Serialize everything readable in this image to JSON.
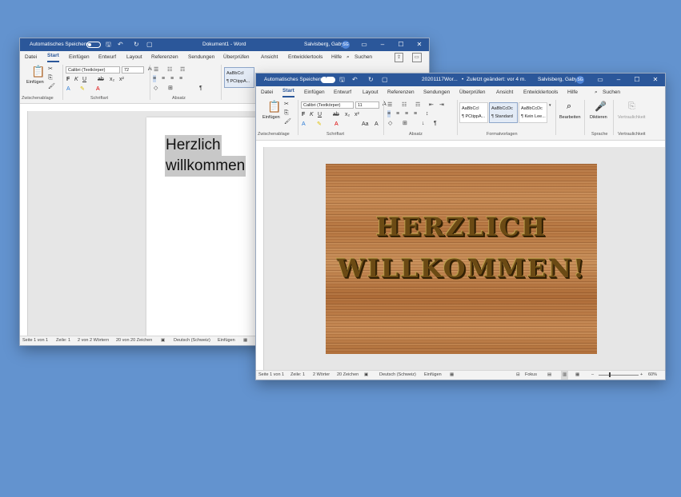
{
  "window1": {
    "autosave_label": "Automatisches Speichern",
    "title": "Dokument1 - Word",
    "user": "Salvisberg, Gaby",
    "user_initials": "SG",
    "tabs": [
      "Datei",
      "Start",
      "Einfügen",
      "Entwurf",
      "Layout",
      "Referenzen",
      "Sendungen",
      "Überprüfen",
      "Ansicht",
      "Entwicklertools",
      "Hilfe"
    ],
    "search_label": "Suchen",
    "font_name": "Calibri (Textkörper)",
    "font_size": "72",
    "paste_label": "Einfügen",
    "clipboard_group": "Zwischenablage",
    "font_group": "Schriftart",
    "paragraph_group": "Absatz",
    "style_preview": "AaBbCcI",
    "style_name": "¶ PCtippA...",
    "doc_lines": [
      "Herzlich",
      "willkommen"
    ],
    "status": {
      "page": "Seite 1 von 1",
      "line": "Zeile: 1",
      "words": "2 von 2 Wörtern",
      "chars": "20 von 20 Zeichen",
      "language": "Deutsch (Schweiz)",
      "mode": "Einfügen"
    }
  },
  "window2": {
    "autosave_label": "Automatisches Speichern",
    "title": "20201117Wor...",
    "subtitle": "Zuletzt geändert: vor 4 m.",
    "user": "Salvisberg, Gaby",
    "user_initials": "SG",
    "tabs": [
      "Datei",
      "Start",
      "Einfügen",
      "Entwurf",
      "Layout",
      "Referenzen",
      "Sendungen",
      "Überprüfen",
      "Ansicht",
      "Entwicklertools",
      "Hilfe"
    ],
    "search_label": "Suchen",
    "font_name": "Calibri (Textkörper)",
    "font_size": "11",
    "paste_label": "Einfügen",
    "groups": [
      "Zwischenablage",
      "Schriftart",
      "Absatz",
      "Formatvorlagen",
      "Sprache",
      "Vertraulichkeit"
    ],
    "styles": [
      {
        "preview": "AaBbCcI",
        "name": "¶ PCtippA..."
      },
      {
        "preview": "AaBbCcDc",
        "name": "¶ Standard"
      },
      {
        "preview": "AaBbCcDc",
        "name": "¶ Kein Lee..."
      }
    ],
    "edit_label": "Bearbeiten",
    "dictate_label": "Diktieren",
    "sensitivity_label": "Vertraulichkeit",
    "wordart_lines": [
      "HERZLICH",
      "WILLKOMMEN!"
    ],
    "status": {
      "page": "Seite 1 von 1",
      "line": "Zeile: 1",
      "words": "2 Wörter",
      "chars": "20 Zeichen",
      "language": "Deutsch (Schweiz)",
      "mode": "Einfügen",
      "focus": "Fokus",
      "zoom": "60%"
    }
  },
  "colors": {
    "desktop": "#6393cf",
    "titlebar": "#2b579a"
  }
}
